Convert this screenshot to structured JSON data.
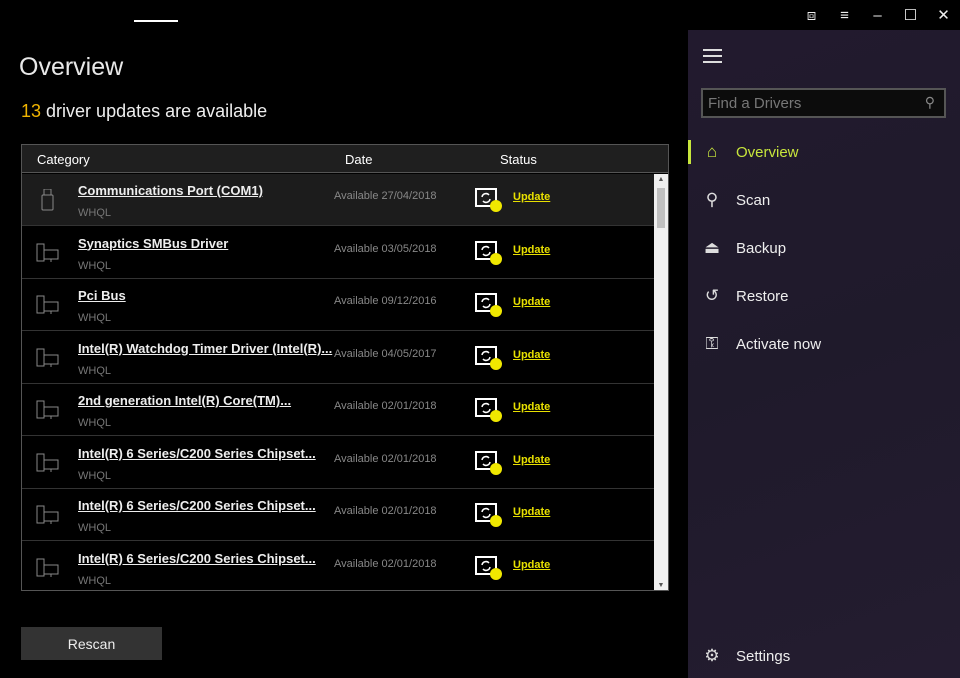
{
  "window": {
    "controls": [
      "⧈",
      "≡",
      "–",
      "☐",
      "✕"
    ]
  },
  "page": {
    "title": "Overview",
    "count": "13",
    "subtitle": "driver updates are available"
  },
  "table": {
    "headers": {
      "category": "Category",
      "date": "Date",
      "status": "Status"
    },
    "rows": [
      {
        "name": "Communications Port (COM1)",
        "cert": "WHQL",
        "date": "Available  27/04/2018",
        "action": "Update",
        "icon": "usb-icon"
      },
      {
        "name": "Synaptics SMBus Driver",
        "cert": "WHQL",
        "date": "Available  03/05/2018",
        "action": "Update",
        "icon": "computer-icon"
      },
      {
        "name": "Pci Bus",
        "cert": "WHQL",
        "date": "Available  09/12/2016",
        "action": "Update",
        "icon": "computer-icon"
      },
      {
        "name": "Intel(R) Watchdog Timer Driver (Intel(R)...",
        "cert": "WHQL",
        "date": "Available  04/05/2017",
        "action": "Update",
        "icon": "computer-icon"
      },
      {
        "name": "2nd generation Intel(R) Core(TM)...",
        "cert": "WHQL",
        "date": "Available  02/01/2018",
        "action": "Update",
        "icon": "computer-icon"
      },
      {
        "name": "Intel(R) 6 Series/C200 Series Chipset...",
        "cert": "WHQL",
        "date": "Available  02/01/2018",
        "action": "Update",
        "icon": "computer-icon"
      },
      {
        "name": "Intel(R) 6 Series/C200 Series Chipset...",
        "cert": "WHQL",
        "date": "Available  02/01/2018",
        "action": "Update",
        "icon": "computer-icon"
      },
      {
        "name": "Intel(R) 6 Series/C200 Series Chipset...",
        "cert": "WHQL",
        "date": "Available  02/01/2018",
        "action": "Update",
        "icon": "computer-icon"
      }
    ]
  },
  "rescan": "Rescan",
  "sidebar": {
    "search_placeholder": "Find a Drivers",
    "items": [
      {
        "label": "Overview",
        "icon": "⌂"
      },
      {
        "label": "Scan",
        "icon": "⚲"
      },
      {
        "label": "Backup",
        "icon": "⏏"
      },
      {
        "label": "Restore",
        "icon": "↺"
      },
      {
        "label": "Activate now",
        "icon": "⚿"
      }
    ],
    "settings": {
      "label": "Settings",
      "icon": "⚙"
    }
  },
  "colors": {
    "accent": "#c8e63c",
    "count": "#f0b400",
    "update": "#e8e000"
  }
}
